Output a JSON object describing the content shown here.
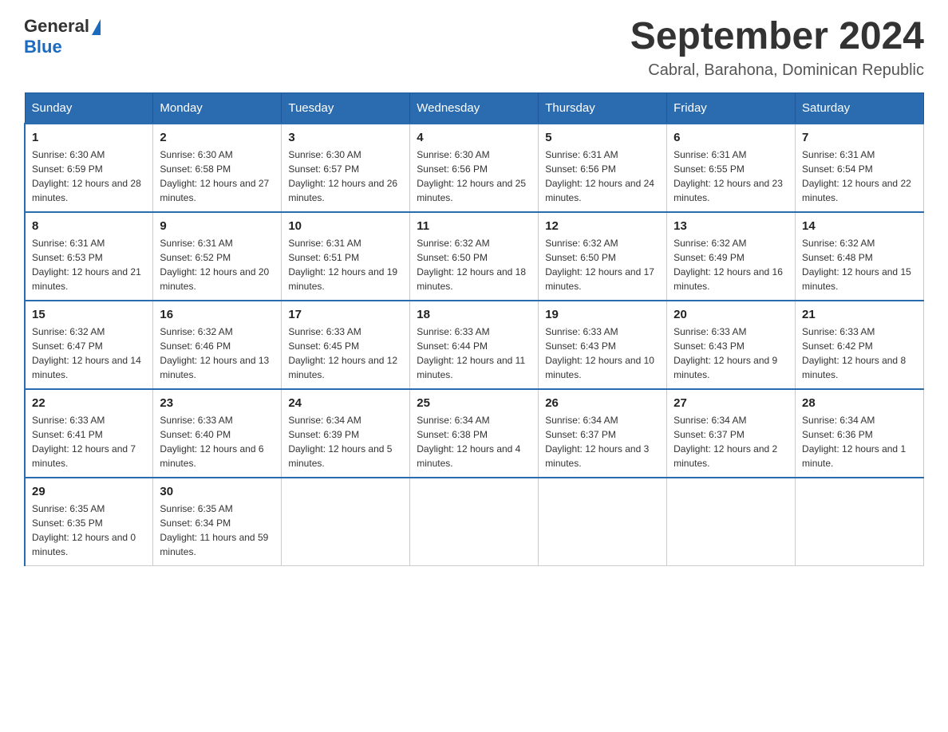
{
  "logo": {
    "general": "General",
    "blue": "Blue"
  },
  "title": "September 2024",
  "subtitle": "Cabral, Barahona, Dominican Republic",
  "weekdays": [
    "Sunday",
    "Monday",
    "Tuesday",
    "Wednesday",
    "Thursday",
    "Friday",
    "Saturday"
  ],
  "weeks": [
    [
      {
        "day": "1",
        "sunrise": "Sunrise: 6:30 AM",
        "sunset": "Sunset: 6:59 PM",
        "daylight": "Daylight: 12 hours and 28 minutes."
      },
      {
        "day": "2",
        "sunrise": "Sunrise: 6:30 AM",
        "sunset": "Sunset: 6:58 PM",
        "daylight": "Daylight: 12 hours and 27 minutes."
      },
      {
        "day": "3",
        "sunrise": "Sunrise: 6:30 AM",
        "sunset": "Sunset: 6:57 PM",
        "daylight": "Daylight: 12 hours and 26 minutes."
      },
      {
        "day": "4",
        "sunrise": "Sunrise: 6:30 AM",
        "sunset": "Sunset: 6:56 PM",
        "daylight": "Daylight: 12 hours and 25 minutes."
      },
      {
        "day": "5",
        "sunrise": "Sunrise: 6:31 AM",
        "sunset": "Sunset: 6:56 PM",
        "daylight": "Daylight: 12 hours and 24 minutes."
      },
      {
        "day": "6",
        "sunrise": "Sunrise: 6:31 AM",
        "sunset": "Sunset: 6:55 PM",
        "daylight": "Daylight: 12 hours and 23 minutes."
      },
      {
        "day": "7",
        "sunrise": "Sunrise: 6:31 AM",
        "sunset": "Sunset: 6:54 PM",
        "daylight": "Daylight: 12 hours and 22 minutes."
      }
    ],
    [
      {
        "day": "8",
        "sunrise": "Sunrise: 6:31 AM",
        "sunset": "Sunset: 6:53 PM",
        "daylight": "Daylight: 12 hours and 21 minutes."
      },
      {
        "day": "9",
        "sunrise": "Sunrise: 6:31 AM",
        "sunset": "Sunset: 6:52 PM",
        "daylight": "Daylight: 12 hours and 20 minutes."
      },
      {
        "day": "10",
        "sunrise": "Sunrise: 6:31 AM",
        "sunset": "Sunset: 6:51 PM",
        "daylight": "Daylight: 12 hours and 19 minutes."
      },
      {
        "day": "11",
        "sunrise": "Sunrise: 6:32 AM",
        "sunset": "Sunset: 6:50 PM",
        "daylight": "Daylight: 12 hours and 18 minutes."
      },
      {
        "day": "12",
        "sunrise": "Sunrise: 6:32 AM",
        "sunset": "Sunset: 6:50 PM",
        "daylight": "Daylight: 12 hours and 17 minutes."
      },
      {
        "day": "13",
        "sunrise": "Sunrise: 6:32 AM",
        "sunset": "Sunset: 6:49 PM",
        "daylight": "Daylight: 12 hours and 16 minutes."
      },
      {
        "day": "14",
        "sunrise": "Sunrise: 6:32 AM",
        "sunset": "Sunset: 6:48 PM",
        "daylight": "Daylight: 12 hours and 15 minutes."
      }
    ],
    [
      {
        "day": "15",
        "sunrise": "Sunrise: 6:32 AM",
        "sunset": "Sunset: 6:47 PM",
        "daylight": "Daylight: 12 hours and 14 minutes."
      },
      {
        "day": "16",
        "sunrise": "Sunrise: 6:32 AM",
        "sunset": "Sunset: 6:46 PM",
        "daylight": "Daylight: 12 hours and 13 minutes."
      },
      {
        "day": "17",
        "sunrise": "Sunrise: 6:33 AM",
        "sunset": "Sunset: 6:45 PM",
        "daylight": "Daylight: 12 hours and 12 minutes."
      },
      {
        "day": "18",
        "sunrise": "Sunrise: 6:33 AM",
        "sunset": "Sunset: 6:44 PM",
        "daylight": "Daylight: 12 hours and 11 minutes."
      },
      {
        "day": "19",
        "sunrise": "Sunrise: 6:33 AM",
        "sunset": "Sunset: 6:43 PM",
        "daylight": "Daylight: 12 hours and 10 minutes."
      },
      {
        "day": "20",
        "sunrise": "Sunrise: 6:33 AM",
        "sunset": "Sunset: 6:43 PM",
        "daylight": "Daylight: 12 hours and 9 minutes."
      },
      {
        "day": "21",
        "sunrise": "Sunrise: 6:33 AM",
        "sunset": "Sunset: 6:42 PM",
        "daylight": "Daylight: 12 hours and 8 minutes."
      }
    ],
    [
      {
        "day": "22",
        "sunrise": "Sunrise: 6:33 AM",
        "sunset": "Sunset: 6:41 PM",
        "daylight": "Daylight: 12 hours and 7 minutes."
      },
      {
        "day": "23",
        "sunrise": "Sunrise: 6:33 AM",
        "sunset": "Sunset: 6:40 PM",
        "daylight": "Daylight: 12 hours and 6 minutes."
      },
      {
        "day": "24",
        "sunrise": "Sunrise: 6:34 AM",
        "sunset": "Sunset: 6:39 PM",
        "daylight": "Daylight: 12 hours and 5 minutes."
      },
      {
        "day": "25",
        "sunrise": "Sunrise: 6:34 AM",
        "sunset": "Sunset: 6:38 PM",
        "daylight": "Daylight: 12 hours and 4 minutes."
      },
      {
        "day": "26",
        "sunrise": "Sunrise: 6:34 AM",
        "sunset": "Sunset: 6:37 PM",
        "daylight": "Daylight: 12 hours and 3 minutes."
      },
      {
        "day": "27",
        "sunrise": "Sunrise: 6:34 AM",
        "sunset": "Sunset: 6:37 PM",
        "daylight": "Daylight: 12 hours and 2 minutes."
      },
      {
        "day": "28",
        "sunrise": "Sunrise: 6:34 AM",
        "sunset": "Sunset: 6:36 PM",
        "daylight": "Daylight: 12 hours and 1 minute."
      }
    ],
    [
      {
        "day": "29",
        "sunrise": "Sunrise: 6:35 AM",
        "sunset": "Sunset: 6:35 PM",
        "daylight": "Daylight: 12 hours and 0 minutes."
      },
      {
        "day": "30",
        "sunrise": "Sunrise: 6:35 AM",
        "sunset": "Sunset: 6:34 PM",
        "daylight": "Daylight: 11 hours and 59 minutes."
      },
      null,
      null,
      null,
      null,
      null
    ]
  ]
}
